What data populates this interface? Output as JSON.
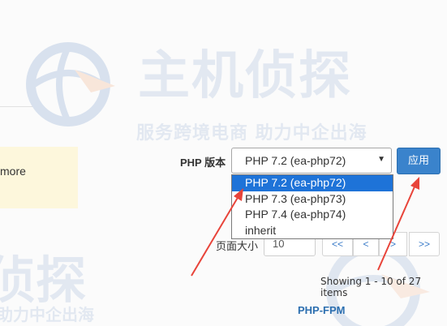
{
  "watermark": {
    "title": "主机侦探",
    "subtitle": "服务跨境电商 助力中企出海",
    "title_partial": "侦探",
    "subtitle_partial": "助力中企出海"
  },
  "notice": {
    "text": "more"
  },
  "php_version": {
    "label": "PHP 版本",
    "selected": "PHP 7.2 (ea-php72)",
    "options": [
      "PHP 7.2 (ea-php72)",
      "PHP 7.3 (ea-php73)",
      "PHP 7.4 (ea-php74)",
      "inherit"
    ],
    "apply_label": "应用"
  },
  "pagination": {
    "page_size_label": "页面大小",
    "page_size_value": "10",
    "first": "<<",
    "prev": "<",
    "next": ">",
    "last": ">>",
    "showing": "Showing 1 - 10 of 27 items"
  },
  "section": {
    "title": "PHP-FPM"
  },
  "colors": {
    "accent": "#3a83cc",
    "selected_option": "#1e73d8",
    "annotation_arrow": "#e8443a",
    "notice_bg": "#fdf7dc"
  }
}
